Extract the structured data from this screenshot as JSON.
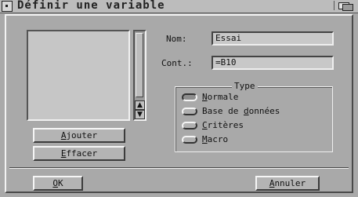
{
  "window": {
    "title": "Définir une variable"
  },
  "list": {
    "add_label": "Ajouter",
    "add_accesskey": "A",
    "add_rest": "jouter",
    "delete_label": "Effacer",
    "delete_accesskey": "E",
    "delete_rest": "ffacer"
  },
  "form": {
    "name_label": "Nom:",
    "name_value": "Essai",
    "content_label": "Cont.:",
    "content_value": "=B10"
  },
  "type_group": {
    "legend": "Type",
    "options": [
      {
        "label": "Normale",
        "accesskey": "N",
        "rest": "ormale",
        "selected": true
      },
      {
        "label": "Base de données",
        "pre": "Base de ",
        "accesskey": "d",
        "rest": "onnées",
        "selected": false
      },
      {
        "label": "Critères",
        "accesskey": "C",
        "rest": "ritères",
        "selected": false
      },
      {
        "label": "Macro",
        "accesskey": "M",
        "rest": "acro",
        "selected": false
      }
    ]
  },
  "footer": {
    "ok_label": "OK",
    "ok_accesskey": "O",
    "ok_rest": "K",
    "cancel_label": "Annuler",
    "cancel_accesskey": "A",
    "cancel_rest": "nnuler"
  },
  "icons": {
    "scroll_up": "up-arrow-icon",
    "scroll_down": "down-arrow-icon",
    "close": "close-icon",
    "depth": "depth-arrange-icon"
  }
}
